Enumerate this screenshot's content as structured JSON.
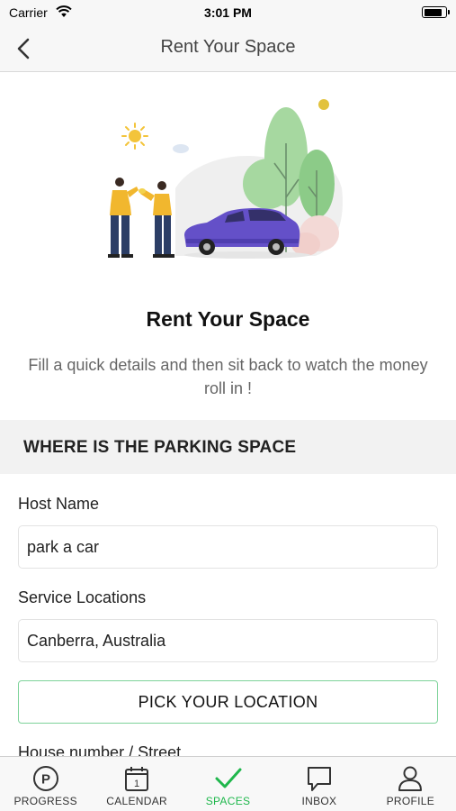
{
  "status_bar": {
    "carrier": "Carrier",
    "time": "3:01 PM",
    "battery_level": 0.85
  },
  "nav": {
    "title": "Rent Your Space",
    "back_icon": "chevron-left-icon"
  },
  "hero": {
    "title": "Rent Your Space",
    "subtitle": "Fill a quick details and then sit back to watch the money roll in !"
  },
  "section": {
    "title": "WHERE IS THE PARKING SPACE"
  },
  "form": {
    "host_name": {
      "label": "Host Name",
      "value": "park a car"
    },
    "service_locations": {
      "label": "Service Locations",
      "value": "Canberra, Australia"
    },
    "pick_location_label": "PICK YOUR LOCATION",
    "house_label": "House number / Street"
  },
  "tab_bar": {
    "active_color": "#1fb74c",
    "items": [
      {
        "label": "PROGRESS",
        "icon": "parking-icon",
        "active": false
      },
      {
        "label": "CALENDAR",
        "icon": "calendar-icon",
        "active": false
      },
      {
        "label": "SPACES",
        "icon": "checkmark-icon",
        "active": true
      },
      {
        "label": "INBOX",
        "icon": "chat-bubble-icon",
        "active": false
      },
      {
        "label": "PROFILE",
        "icon": "person-icon",
        "active": false
      }
    ]
  }
}
